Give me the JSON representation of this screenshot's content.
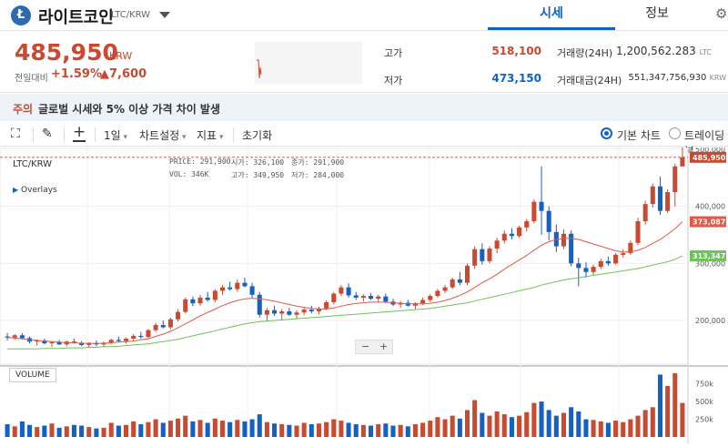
{
  "header": {
    "coin_logo_letter": "Ł",
    "coin_name": "라이트코인",
    "pair": "LTC/KRW",
    "tabs": [
      {
        "label": "시세",
        "active": true
      },
      {
        "label": "정보",
        "active": false
      }
    ]
  },
  "price": {
    "current": "485,950",
    "unit": "KRW",
    "change_label": "전일대비",
    "change_rate": "+1.59%",
    "change_value": "▲7,600",
    "high_label": "고가",
    "high_value": "518,100",
    "low_label": "저가",
    "low_value": "473,150",
    "volume_label": "거래량(24H)",
    "volume_value": "1,200,562.283",
    "volume_unit": "LTC",
    "amount_label": "거래대금(24H)",
    "amount_value": "551,347,756,930",
    "amount_unit": "KRW"
  },
  "notice": {
    "tag": "주의",
    "text": "글로벌 시세와 5% 이상 가격 차이 발생"
  },
  "toolbar": {
    "period": "1일",
    "chart_settings": "차트설정",
    "indicators": "지표",
    "reset": "초기화",
    "basic_chart": "기본 차트",
    "tradingview": "트레이딩뷰"
  },
  "chart_info": {
    "pair": "LTC/KRW",
    "overlays": "Overlays",
    "price_label": "PRICE:",
    "price_value": "291,900",
    "open_label": "시가:",
    "open_value": "326,100",
    "close_label": "종가:",
    "close_value": "291,900",
    "vol_label": "VOL:",
    "vol_value": "346K",
    "high_label": "고가:",
    "high_value": "349,950",
    "low_label": "저가:",
    "low_value": "284,000",
    "volume_label": "VOLUME",
    "zoom_minus": "−",
    "zoom_plus": "+"
  },
  "colors": {
    "up": "#c84a31",
    "down": "#1261c4",
    "ma_short": "#e05a4a",
    "ma_long": "#6dc35a"
  },
  "chart_data": {
    "type": "candlestick",
    "y_ticks": [
      200000,
      300000,
      400000,
      500000
    ],
    "y_tick_labels": [
      "200,000",
      "300,000",
      "400,000",
      "500,000"
    ],
    "current_marker": "485,950",
    "ma_short_marker": "373,087",
    "ma_long_marker": "313,347",
    "volume_ticks": [
      "750k",
      "500k",
      "250k"
    ],
    "candles": [
      [
        172000,
        178000,
        165000,
        170000
      ],
      [
        170000,
        176000,
        166000,
        174000
      ],
      [
        174000,
        178000,
        167000,
        169000
      ],
      [
        169000,
        172000,
        160000,
        163000
      ],
      [
        163000,
        167000,
        156000,
        165000
      ],
      [
        165000,
        168000,
        158000,
        160000
      ],
      [
        160000,
        164000,
        154000,
        162000
      ],
      [
        162000,
        166000,
        157000,
        158000
      ],
      [
        158000,
        165000,
        155000,
        163000
      ],
      [
        163000,
        168000,
        159000,
        161000
      ],
      [
        161000,
        164000,
        155000,
        157000
      ],
      [
        157000,
        162000,
        152000,
        160000
      ],
      [
        160000,
        165000,
        155000,
        158000
      ],
      [
        158000,
        163000,
        153000,
        161000
      ],
      [
        161000,
        168000,
        158000,
        166000
      ],
      [
        166000,
        172000,
        162000,
        164000
      ],
      [
        164000,
        170000,
        160000,
        168000
      ],
      [
        168000,
        176000,
        165000,
        173000
      ],
      [
        173000,
        180000,
        168000,
        171000
      ],
      [
        171000,
        185000,
        169000,
        183000
      ],
      [
        183000,
        196000,
        180000,
        192000
      ],
      [
        192000,
        200000,
        186000,
        188000
      ],
      [
        188000,
        205000,
        185000,
        202000
      ],
      [
        202000,
        220000,
        198000,
        215000
      ],
      [
        215000,
        240000,
        212000,
        237000
      ],
      [
        237000,
        242000,
        225000,
        230000
      ],
      [
        230000,
        245000,
        226000,
        240000
      ],
      [
        240000,
        250000,
        233000,
        236000
      ],
      [
        236000,
        255000,
        232000,
        252000
      ],
      [
        252000,
        262000,
        245000,
        258000
      ],
      [
        258000,
        268000,
        252000,
        255000
      ],
      [
        255000,
        272000,
        250000,
        266000
      ],
      [
        266000,
        275000,
        258000,
        260000
      ],
      [
        260000,
        266000,
        240000,
        245000
      ],
      [
        245000,
        250000,
        205000,
        210000
      ],
      [
        210000,
        222000,
        198000,
        218000
      ],
      [
        218000,
        226000,
        208000,
        212000
      ],
      [
        212000,
        220000,
        200000,
        216000
      ],
      [
        216000,
        222000,
        208000,
        210000
      ],
      [
        210000,
        218000,
        203000,
        214000
      ],
      [
        214000,
        222000,
        209000,
        219000
      ],
      [
        219000,
        226000,
        212000,
        216000
      ],
      [
        216000,
        224000,
        211000,
        221000
      ],
      [
        221000,
        235000,
        218000,
        232000
      ],
      [
        232000,
        250000,
        228000,
        247000
      ],
      [
        247000,
        262000,
        243000,
        258000
      ],
      [
        258000,
        265000,
        240000,
        244000
      ],
      [
        244000,
        250000,
        236000,
        240000
      ],
      [
        240000,
        246000,
        233000,
        243000
      ],
      [
        243000,
        248000,
        236000,
        238000
      ],
      [
        238000,
        245000,
        232000,
        242000
      ],
      [
        242000,
        247000,
        230000,
        233000
      ],
      [
        233000,
        238000,
        225000,
        228000
      ],
      [
        228000,
        234000,
        222000,
        231000
      ],
      [
        231000,
        236000,
        224000,
        226000
      ],
      [
        226000,
        232000,
        220000,
        230000
      ],
      [
        230000,
        240000,
        227000,
        236000
      ],
      [
        236000,
        246000,
        232000,
        243000
      ],
      [
        243000,
        255000,
        240000,
        252000
      ],
      [
        252000,
        262000,
        248000,
        258000
      ],
      [
        258000,
        275000,
        255000,
        272000
      ],
      [
        272000,
        285000,
        262000,
        266000
      ],
      [
        266000,
        300000,
        262000,
        296000
      ],
      [
        296000,
        330000,
        290000,
        325000
      ],
      [
        325000,
        335000,
        298000,
        304000
      ],
      [
        304000,
        330000,
        300000,
        326000
      ],
      [
        326000,
        345000,
        318000,
        340000
      ],
      [
        340000,
        358000,
        335000,
        352000
      ],
      [
        352000,
        362000,
        342000,
        348000
      ],
      [
        348000,
        366000,
        345000,
        363000
      ],
      [
        363000,
        378000,
        356000,
        374000
      ],
      [
        374000,
        412000,
        370000,
        408000
      ],
      [
        408000,
        470000,
        350000,
        392000
      ],
      [
        392000,
        400000,
        340000,
        355000
      ],
      [
        355000,
        368000,
        320000,
        330000
      ],
      [
        330000,
        360000,
        325000,
        352000
      ],
      [
        352000,
        358000,
        295000,
        300000
      ],
      [
        300000,
        310000,
        260000,
        292000
      ],
      [
        292000,
        302000,
        275000,
        285000
      ],
      [
        285000,
        298000,
        280000,
        294000
      ],
      [
        294000,
        308000,
        290000,
        304000
      ],
      [
        304000,
        312000,
        296000,
        300000
      ],
      [
        300000,
        318000,
        298000,
        315000
      ],
      [
        315000,
        325000,
        310000,
        318000
      ],
      [
        318000,
        340000,
        315000,
        336000
      ],
      [
        336000,
        380000,
        332000,
        374000
      ],
      [
        374000,
        410000,
        368000,
        404000
      ],
      [
        404000,
        440000,
        398000,
        435000
      ],
      [
        435000,
        452000,
        385000,
        392000
      ],
      [
        392000,
        430000,
        388000,
        425000
      ],
      [
        425000,
        475000,
        400000,
        470000
      ],
      [
        470000,
        518100,
        473150,
        485950
      ]
    ],
    "volumes": [
      180,
      150,
      220,
      170,
      140,
      160,
      190,
      130,
      150,
      170,
      160,
      140,
      120,
      130,
      200,
      160,
      170,
      220,
      180,
      210,
      250,
      200,
      230,
      260,
      300,
      220,
      240,
      200,
      260,
      230,
      210,
      240,
      220,
      250,
      320,
      210,
      190,
      180,
      170,
      160,
      200,
      180,
      190,
      210,
      250,
      230,
      200,
      180,
      170,
      160,
      180,
      190,
      160,
      170,
      150,
      180,
      200,
      230,
      280,
      250,
      300,
      260,
      380,
      520,
      340,
      300,
      360,
      320,
      280,
      300,
      350,
      480,
      500,
      380,
      300,
      340,
      420,
      360,
      250,
      240,
      220,
      200,
      230,
      210,
      250,
      300,
      380,
      420,
      880,
      720,
      900,
      480
    ],
    "ma_short": [
      170000,
      169000,
      168000,
      166000,
      165000,
      164000,
      163000,
      162000,
      161000,
      161000,
      160000,
      160000,
      160000,
      160000,
      161000,
      162000,
      163000,
      164000,
      166000,
      168000,
      172000,
      176000,
      181000,
      187000,
      194000,
      201000,
      208000,
      214000,
      220000,
      226000,
      231000,
      235000,
      238000,
      239000,
      238000,
      236000,
      234000,
      231000,
      228000,
      225000,
      223000,
      221000,
      220000,
      220000,
      222000,
      225000,
      228000,
      230000,
      231000,
      232000,
      232000,
      232000,
      231000,
      230000,
      229000,
      229000,
      229000,
      230000,
      232000,
      235000,
      239000,
      244000,
      250000,
      258000,
      266000,
      273000,
      281000,
      290000,
      298000,
      306000,
      314000,
      323000,
      332000,
      338000,
      342000,
      344000,
      344000,
      342000,
      338000,
      334000,
      330000,
      326000,
      322000,
      320000,
      320000,
      323000,
      328000,
      335000,
      342000,
      351000,
      361000,
      373087
    ],
    "ma_long": [
      150000,
      150000,
      150000,
      150000,
      150000,
      151000,
      151000,
      151000,
      152000,
      152000,
      152000,
      153000,
      153000,
      154000,
      154000,
      155000,
      156000,
      157000,
      158000,
      159000,
      161000,
      163000,
      165000,
      167000,
      170000,
      173000,
      176000,
      179000,
      182000,
      185000,
      188000,
      191000,
      194000,
      196000,
      198000,
      199000,
      200000,
      201000,
      202000,
      203000,
      204000,
      205000,
      206000,
      207000,
      208000,
      209000,
      210000,
      211000,
      212000,
      213000,
      214000,
      215000,
      216000,
      217000,
      218000,
      219000,
      220000,
      221000,
      223000,
      225000,
      227000,
      229000,
      231000,
      234000,
      237000,
      240000,
      243000,
      246000,
      249000,
      252000,
      255000,
      258000,
      262000,
      265000,
      268000,
      271000,
      273000,
      275000,
      277000,
      279000,
      281000,
      283000,
      285000,
      287000,
      289000,
      291000,
      294000,
      297000,
      300000,
      303000,
      307000,
      313347
    ]
  }
}
